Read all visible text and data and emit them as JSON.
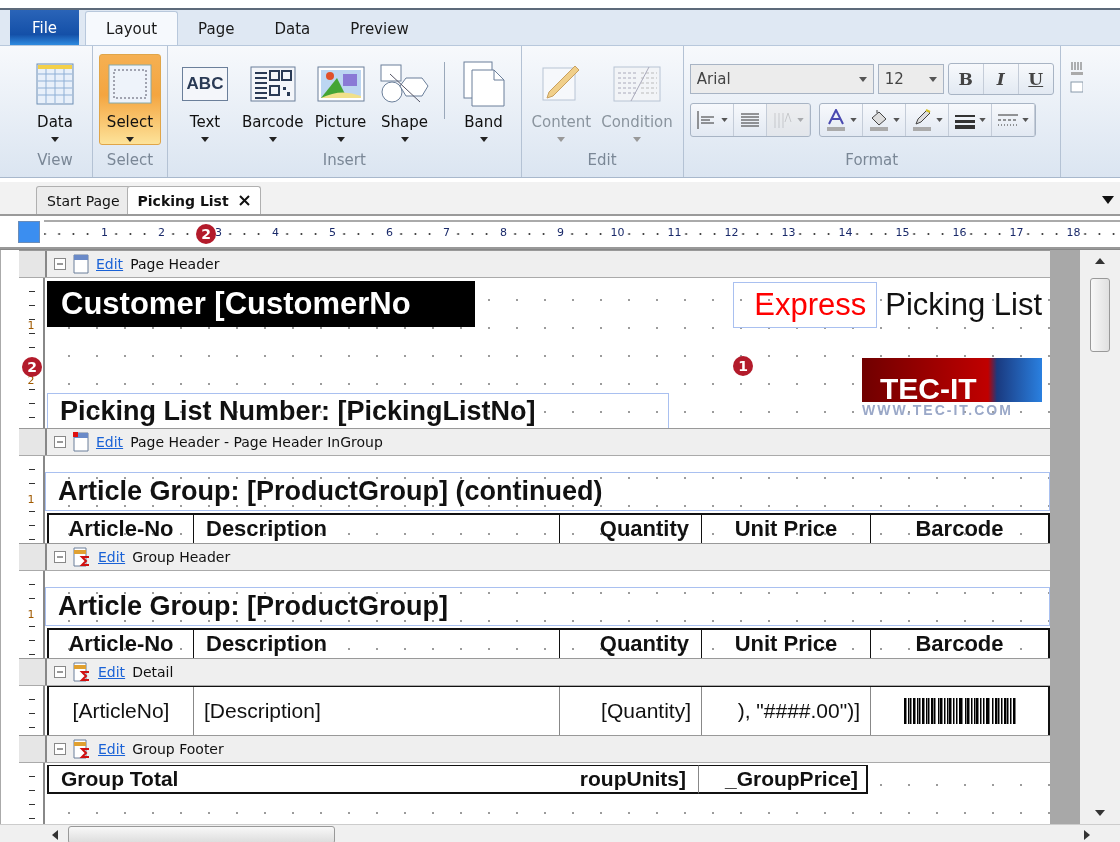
{
  "menu_tabs": [
    {
      "label": "File",
      "kind": "file",
      "selected": false
    },
    {
      "label": "Layout",
      "kind": "tab",
      "selected": true
    },
    {
      "label": "Page",
      "kind": "tab",
      "selected": false
    },
    {
      "label": "Data",
      "kind": "tab",
      "selected": false
    },
    {
      "label": "Preview",
      "kind": "tab",
      "selected": false
    }
  ],
  "ribbon": {
    "groups": [
      {
        "label": "View",
        "kind": "buttons",
        "buttons": [
          {
            "label": "Data",
            "selected": false,
            "disabled": false
          }
        ]
      },
      {
        "label": "Select",
        "kind": "buttons",
        "buttons": [
          {
            "label": "Select",
            "selected": true,
            "disabled": false
          }
        ]
      },
      {
        "label": "Insert",
        "kind": "buttons",
        "buttons": [
          {
            "label": "Text",
            "icon_text": "ABC",
            "selected": false,
            "disabled": false
          },
          {
            "label": "Barcode",
            "selected": false,
            "disabled": false
          },
          {
            "label": "Picture",
            "selected": false,
            "disabled": false
          },
          {
            "label": "Shape",
            "selected": false,
            "disabled": false
          },
          {
            "label": "Band",
            "selected": false,
            "disabled": false
          }
        ]
      },
      {
        "label": "Edit",
        "kind": "buttons",
        "buttons": [
          {
            "label": "Content",
            "selected": false,
            "disabled": true
          },
          {
            "label": "Condition",
            "selected": false,
            "disabled": true
          }
        ]
      },
      {
        "label": "Format",
        "kind": "format",
        "font": "Arial",
        "size": "12",
        "styles": [
          "B",
          "I",
          "U"
        ],
        "tools": [
          {
            "disabled": false
          },
          {
            "disabled": false
          },
          {
            "disabled": true
          },
          {
            "disabled": false
          },
          {
            "disabled": false
          },
          {
            "disabled": false
          },
          {
            "disabled": false
          },
          {
            "disabled": false
          }
        ]
      }
    ]
  },
  "doc_tabs": [
    {
      "label": "Start Page",
      "selected": false,
      "closable": false
    },
    {
      "label": "Picking List",
      "selected": true,
      "closable": true
    }
  ],
  "ruler": {
    "marks": [
      {
        "label": "1"
      },
      {
        "label": "2"
      },
      {
        "label": "3",
        "callout": "2"
      },
      {
        "label": "4"
      },
      {
        "label": "5"
      },
      {
        "label": "6"
      },
      {
        "label": "7"
      },
      {
        "label": "8"
      },
      {
        "label": "9"
      },
      {
        "label": "10"
      },
      {
        "label": "11"
      },
      {
        "label": "12"
      },
      {
        "label": "13"
      },
      {
        "label": "14"
      },
      {
        "label": "15"
      },
      {
        "label": "16"
      },
      {
        "label": "17"
      },
      {
        "label": "18"
      }
    ]
  },
  "bands": [
    {
      "kind": "page-header",
      "label": "Page Header",
      "edit": "Edit",
      "ruler": [
        "1",
        "2"
      ],
      "ruler_callout": "2",
      "customer": "Customer [CustomerNo",
      "express": "Express",
      "title": "Picking List",
      "logo": {
        "name": "TEC-IT",
        "url": "WWW.TEC-IT.COM"
      },
      "number": "Picking List Number: [PickingListNo]",
      "callout": "1"
    },
    {
      "kind": "group-heading",
      "label": "Page Header - Page Header InGroup",
      "edit": "Edit",
      "ruler": [
        "1"
      ],
      "heading": "Article Group: [ProductGroup] (continued)",
      "columns": [
        "Article-No",
        "Description",
        "Quantity",
        "Unit Price",
        "Barcode"
      ]
    },
    {
      "kind": "group-heading",
      "label": "Group Header",
      "edit": "Edit",
      "ruler": [
        "1"
      ],
      "heading": "Article Group: [ProductGroup]",
      "columns": [
        "Article-No",
        "Description",
        "Quantity",
        "Unit Price",
        "Barcode"
      ]
    },
    {
      "kind": "detail",
      "label": "Detail",
      "edit": "Edit",
      "cells": [
        "[ArticleNo]",
        "[Description]",
        "[Quantity]",
        "), \"####.00\")]"
      ]
    },
    {
      "kind": "footer",
      "label": "Group Footer",
      "edit": "Edit",
      "cells": [
        "Group Total",
        "roupUnits]",
        "_GroupPrice]"
      ]
    }
  ]
}
